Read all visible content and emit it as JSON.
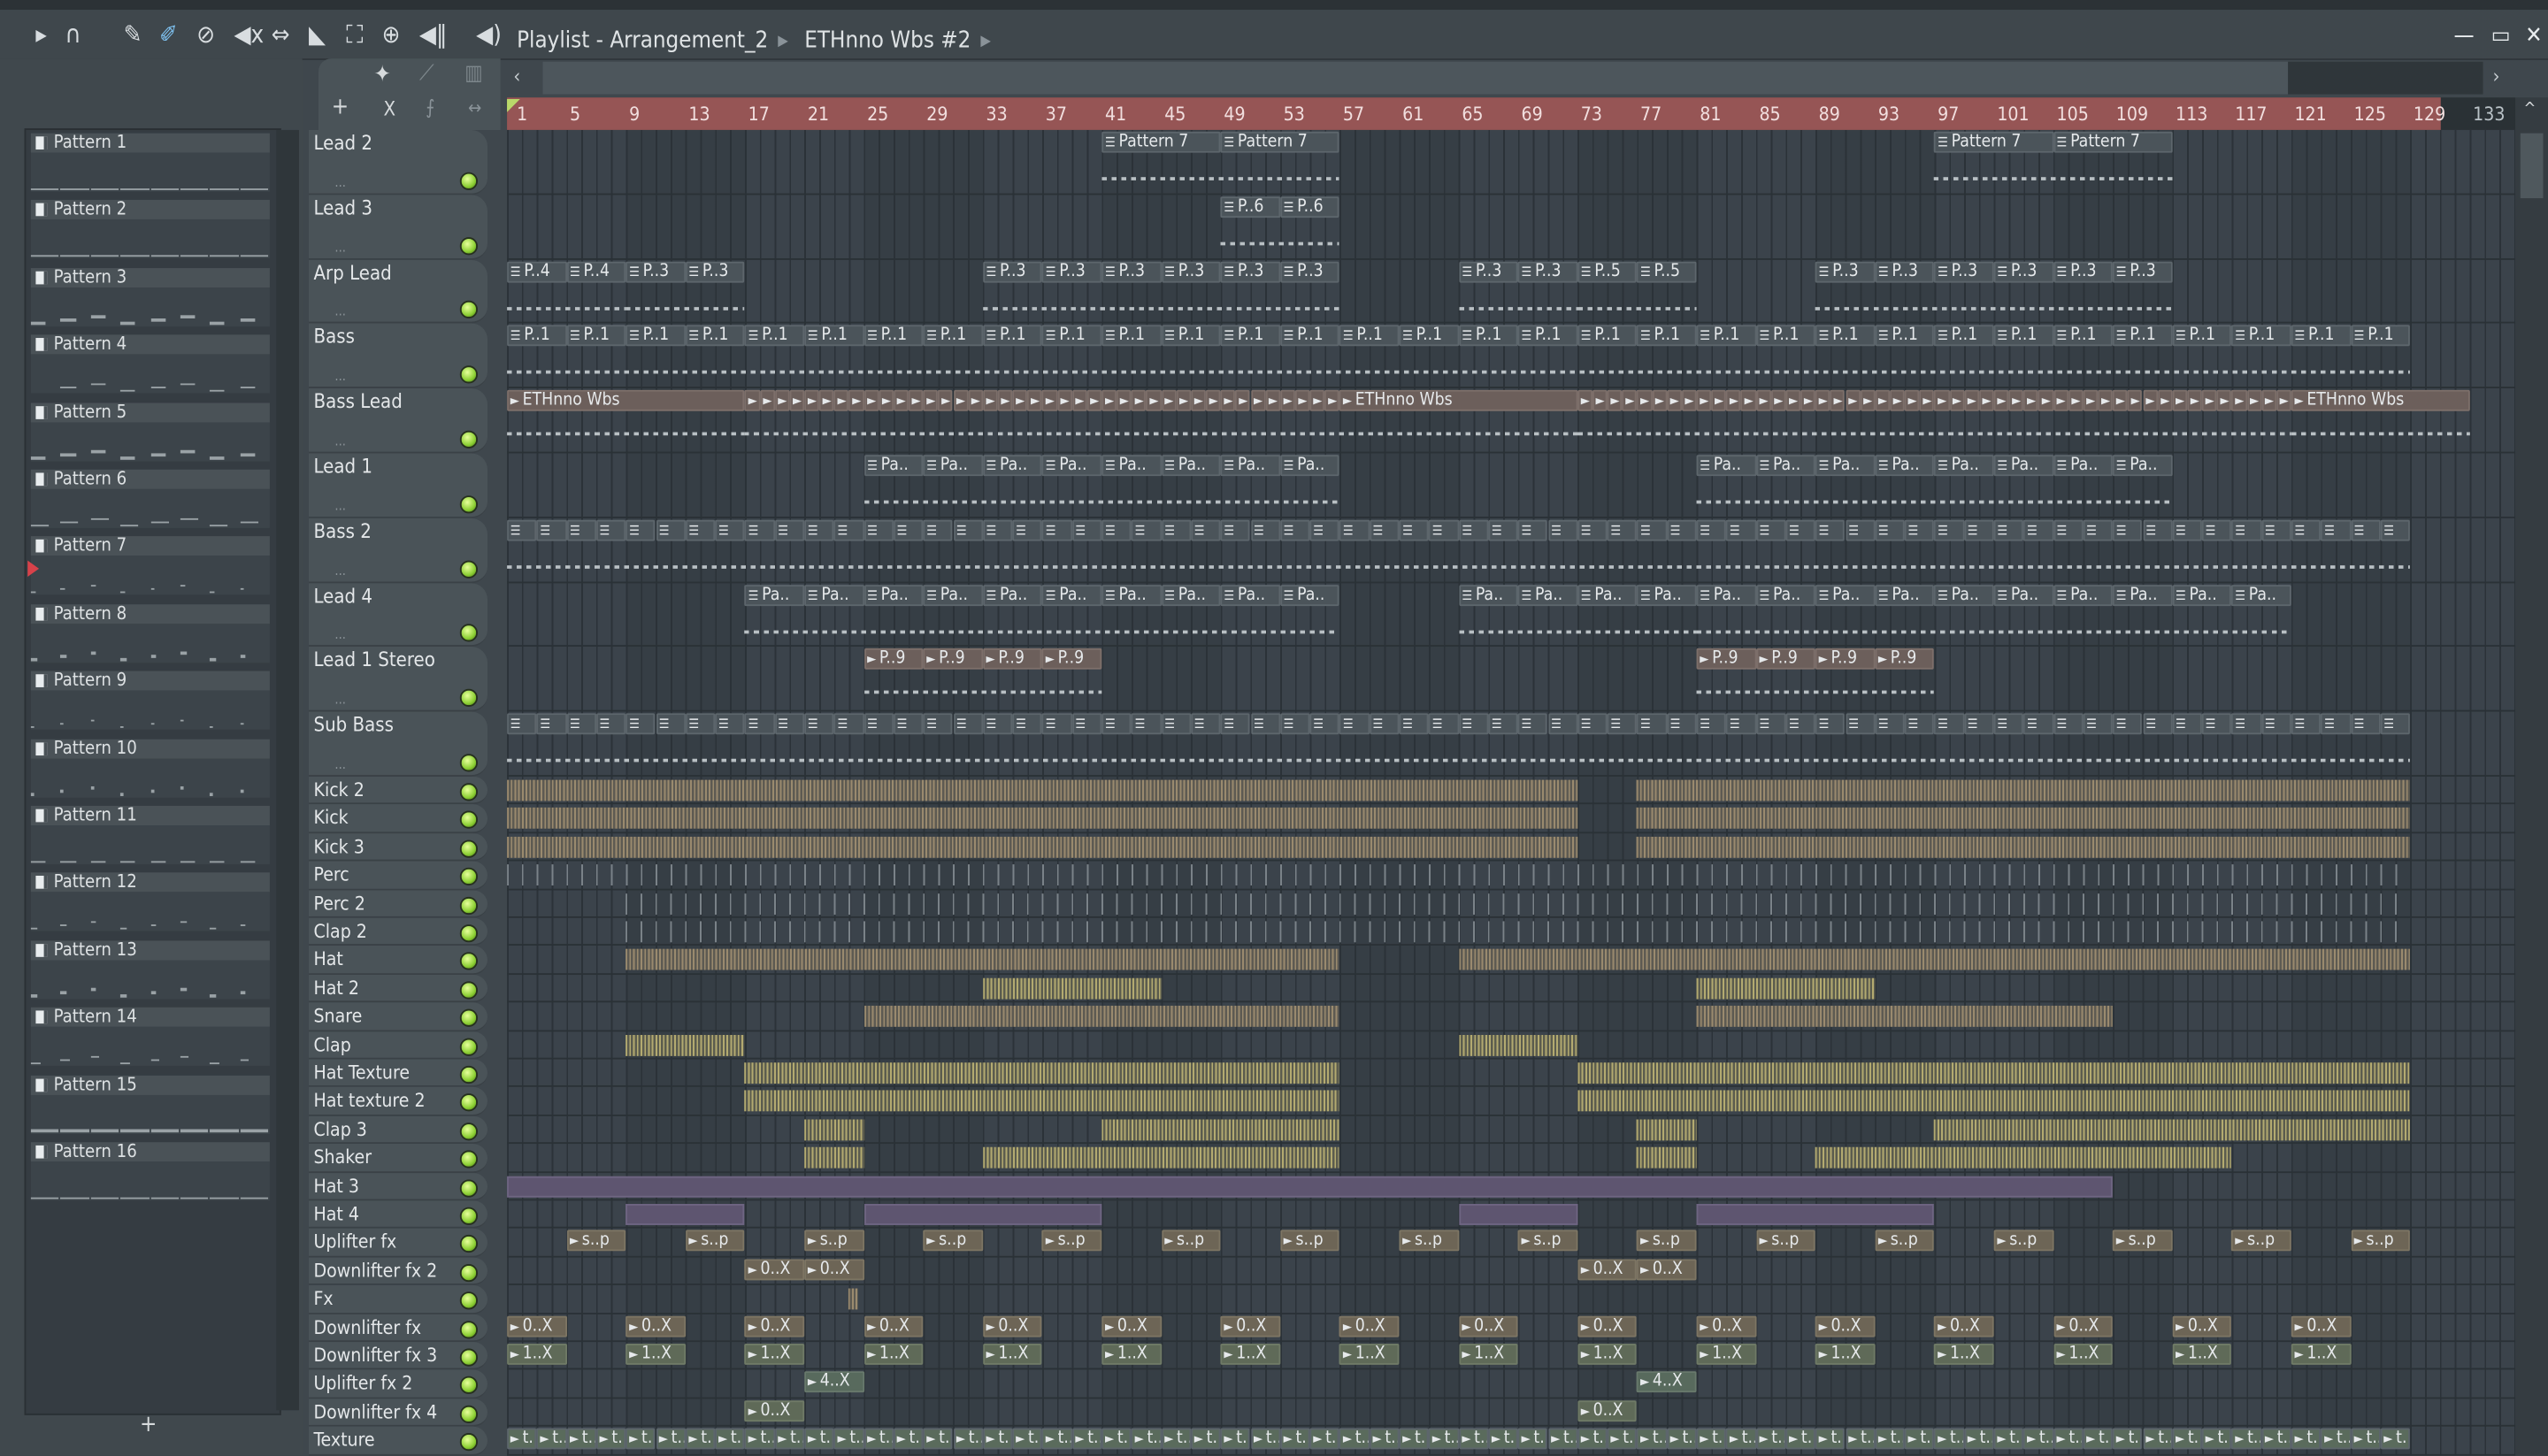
{
  "window": {
    "title_parts": [
      "Playlist - Arrangement_2",
      "ETHnno Wbs #2"
    ],
    "controls": {
      "minimize": "—",
      "maximize": "▭",
      "close": "✕"
    }
  },
  "toolbar_icons": [
    "play-arrow",
    "magnet-snap",
    "pencil",
    "paint-brush",
    "mute-delete",
    "mute-speaker",
    "slip",
    "slice",
    "select",
    "zoom",
    "playback",
    "speaker"
  ],
  "left_tabs": [
    "piano-roll",
    "audio",
    "automation"
  ],
  "picker": {
    "patterns": [
      "Pattern 1",
      "Pattern 2",
      "Pattern 3",
      "Pattern 4",
      "Pattern 5",
      "Pattern 6",
      "Pattern 7",
      "Pattern 8",
      "Pattern 9",
      "Pattern 10",
      "Pattern 11",
      "Pattern 12",
      "Pattern 13",
      "Pattern 14",
      "Pattern 15",
      "Pattern 16"
    ],
    "add_label": "+"
  },
  "tool_column": {
    "add": "+",
    "close": "X"
  },
  "ruler": {
    "bars": [
      1,
      5,
      9,
      13,
      17,
      21,
      25,
      29,
      33,
      37,
      41,
      45,
      49,
      53,
      57,
      61,
      65,
      69,
      73,
      77,
      81,
      85,
      89,
      93,
      97,
      101,
      105,
      109,
      113,
      117,
      121,
      125,
      129,
      133
    ],
    "song_end_bar": 131
  },
  "colors": {
    "ruler_active": "#965555",
    "led": "#8ccf33",
    "pattern_clip": "#4b545a",
    "audio_clip": "#6c5f5b"
  },
  "tracks": [
    {
      "name": "Lead 2",
      "kind": "tall",
      "clips": [
        [
          41,
          2,
          8,
          8,
          "Pattern 7",
          "p"
        ],
        [
          97,
          2,
          8,
          8,
          "Pattern 7",
          "p"
        ]
      ]
    },
    {
      "name": "Lead 3",
      "kind": "tall",
      "clips": [
        [
          49,
          2,
          4,
          4,
          "P..6",
          "p"
        ]
      ]
    },
    {
      "name": "Arp Lead",
      "kind": "tall",
      "clips": [
        [
          1,
          2,
          4,
          4,
          "P..4",
          "p"
        ],
        [
          9,
          2,
          4,
          4,
          "P..3",
          "p"
        ],
        [
          33,
          6,
          4,
          4,
          "P..3",
          "p"
        ],
        [
          65,
          2,
          4,
          4,
          "P..3",
          "p"
        ],
        [
          73,
          2,
          4,
          4,
          "P..5",
          "p"
        ],
        [
          89,
          6,
          4,
          4,
          "P..3",
          "p"
        ]
      ]
    },
    {
      "name": "Bass",
      "kind": "tall",
      "clips": [
        [
          1,
          32,
          4,
          4,
          "P..1",
          "p"
        ]
      ]
    },
    {
      "name": "Bass Lead",
      "kind": "tall",
      "clips": [
        [
          1,
          1,
          16,
          16,
          "ETHnno Wbs",
          "a"
        ],
        [
          17,
          40,
          1,
          1,
          "",
          "a"
        ],
        [
          57,
          1,
          16,
          16,
          "ETHnno Wbs",
          "a"
        ],
        [
          73,
          48,
          1,
          1,
          "",
          "a"
        ],
        [
          121,
          1,
          12,
          12,
          "ETHnno Wbs",
          "a"
        ]
      ]
    },
    {
      "name": "Lead 1",
      "kind": "tall",
      "clips": [
        [
          25,
          8,
          4,
          4,
          "Pa..",
          "p"
        ],
        [
          81,
          8,
          4,
          4,
          "Pa..",
          "p"
        ]
      ]
    },
    {
      "name": "Bass 2",
      "kind": "tall",
      "clips": [
        [
          1,
          64,
          2,
          2,
          "",
          "p"
        ]
      ]
    },
    {
      "name": "Lead 4",
      "kind": "tall",
      "clips": [
        [
          17,
          10,
          4,
          4,
          "Pa..",
          "p"
        ],
        [
          65,
          4,
          4,
          4,
          "Pa..",
          "p"
        ],
        [
          81,
          10,
          4,
          4,
          "Pa..",
          "p"
        ]
      ]
    },
    {
      "name": "Lead 1 Stereo",
      "kind": "tall",
      "clips": [
        [
          25,
          4,
          4,
          4,
          "P..9",
          "a"
        ],
        [
          81,
          4,
          4,
          4,
          "P..9",
          "a"
        ]
      ]
    },
    {
      "name": "Sub Bass",
      "kind": "tall",
      "clips": [
        [
          1,
          64,
          2,
          2,
          "",
          "p"
        ]
      ]
    },
    {
      "name": "Kick 2",
      "kind": "small",
      "regions": [
        [
          1,
          73,
          "drums"
        ],
        [
          77,
          129,
          "drums"
        ]
      ]
    },
    {
      "name": "Kick",
      "kind": "small",
      "regions": [
        [
          1,
          73,
          "drums"
        ],
        [
          77,
          129,
          "drums"
        ]
      ]
    },
    {
      "name": "Kick 3",
      "kind": "small",
      "regions": [
        [
          1,
          73,
          "drums"
        ],
        [
          77,
          129,
          "drums"
        ]
      ]
    },
    {
      "name": "Perc",
      "kind": "small",
      "regions": [
        [
          1,
          129,
          "sparse"
        ]
      ]
    },
    {
      "name": "Perc 2",
      "kind": "small",
      "regions": [
        [
          9,
          129,
          "sparse"
        ]
      ]
    },
    {
      "name": "Clap 2",
      "kind": "small",
      "regions": [
        [
          9,
          129,
          "sparse"
        ]
      ]
    },
    {
      "name": "Hat",
      "kind": "small",
      "regions": [
        [
          9,
          57,
          "drums"
        ],
        [
          65,
          129,
          "drums"
        ]
      ]
    },
    {
      "name": "Hat 2",
      "kind": "small",
      "regions": [
        [
          33,
          45,
          "hats"
        ],
        [
          81,
          93,
          "hats"
        ]
      ]
    },
    {
      "name": "Snare",
      "kind": "small",
      "regions": [
        [
          25,
          57,
          "drums"
        ],
        [
          81,
          109,
          "drums"
        ]
      ]
    },
    {
      "name": "Clap",
      "kind": "small",
      "regions": [
        [
          9,
          17,
          "hats"
        ],
        [
          65,
          73,
          "hats"
        ]
      ]
    },
    {
      "name": "Hat Texture",
      "kind": "small",
      "regions": [
        [
          17,
          57,
          "hats"
        ],
        [
          73,
          129,
          "hats"
        ]
      ]
    },
    {
      "name": "Hat texture 2",
      "kind": "small",
      "regions": [
        [
          17,
          57,
          "hats"
        ],
        [
          73,
          129,
          "hats"
        ]
      ]
    },
    {
      "name": "Clap 3",
      "kind": "small",
      "regions": [
        [
          21,
          25,
          "hats"
        ],
        [
          41,
          57,
          "hats"
        ],
        [
          77,
          81,
          "hats"
        ],
        [
          97,
          129,
          "hats"
        ]
      ]
    },
    {
      "name": "Shaker",
      "kind": "small",
      "regions": [
        [
          21,
          25,
          "hats"
        ],
        [
          33,
          57,
          "hats"
        ],
        [
          77,
          81,
          "hats"
        ],
        [
          89,
          117,
          "hats"
        ]
      ]
    },
    {
      "name": "Hat 3",
      "kind": "small",
      "regions": [
        [
          1,
          109,
          "purple"
        ]
      ]
    },
    {
      "name": "Hat 4",
      "kind": "small",
      "regions": [
        [
          9,
          17,
          "purple"
        ],
        [
          25,
          41,
          "purple"
        ],
        [
          65,
          73,
          "purple"
        ],
        [
          81,
          97,
          "purple"
        ]
      ]
    },
    {
      "name": "Uplifter fx",
      "kind": "small",
      "clips": [
        [
          5,
          16,
          8,
          4,
          "s..p",
          "brown"
        ]
      ]
    },
    {
      "name": "Downlifter fx 2",
      "kind": "small",
      "clips": [
        [
          17,
          2,
          4,
          4,
          "0..X",
          "brown"
        ],
        [
          73,
          2,
          4,
          4,
          "0..X",
          "brown"
        ]
      ]
    },
    {
      "name": "Fx",
      "kind": "small",
      "regions": [
        [
          24,
          24.6,
          "drums"
        ]
      ]
    },
    {
      "name": "Downlifter fx",
      "kind": "small",
      "clips": [
        [
          1,
          16,
          8,
          4,
          "0..X",
          "brown"
        ]
      ]
    },
    {
      "name": "Downlifter fx 3",
      "kind": "small",
      "clips": [
        [
          1,
          16,
          8,
          4,
          "1..X",
          "green"
        ]
      ]
    },
    {
      "name": "Uplifter fx 2",
      "kind": "small",
      "clips": [
        [
          21,
          1,
          4,
          4,
          "4..X",
          "mint"
        ],
        [
          77,
          1,
          4,
          4,
          "4..X",
          "mint"
        ]
      ]
    },
    {
      "name": "Downlifter fx 4",
      "kind": "small",
      "clips": [
        [
          17,
          1,
          4,
          4,
          "0..X",
          "green"
        ],
        [
          73,
          1,
          4,
          4,
          "0..X",
          "green"
        ]
      ]
    },
    {
      "name": "Texture",
      "kind": "small",
      "clips": [
        [
          1,
          64,
          2,
          2,
          "t..ro",
          "texture"
        ]
      ]
    }
  ]
}
